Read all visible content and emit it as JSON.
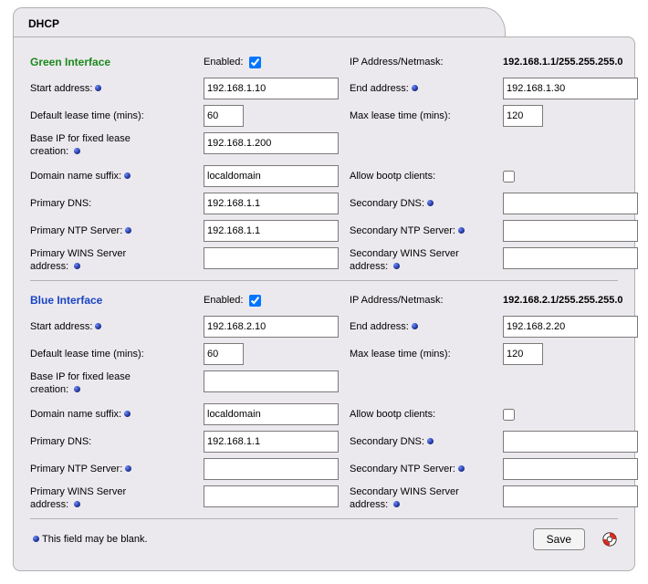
{
  "title": "DHCP",
  "labels": {
    "enabled": "Enabled:",
    "ip_netmask": "IP Address/Netmask:",
    "start_address": "Start address:",
    "end_address": "End address:",
    "default_lease": "Default lease time (mins):",
    "max_lease": "Max lease time (mins):",
    "base_ip_l1": "Base IP for fixed lease",
    "base_ip_l2": "creation:",
    "domain_suffix": "Domain name suffix:",
    "allow_bootp": "Allow bootp clients:",
    "primary_dns": "Primary DNS:",
    "secondary_dns": "Secondary DNS:",
    "primary_ntp": "Primary NTP Server:",
    "secondary_ntp": "Secondary NTP Server:",
    "primary_wins_l1": "Primary WINS Server",
    "primary_wins_l2": "address:",
    "secondary_wins_l1": "Secondary WINS Server",
    "secondary_wins_l2": "address:",
    "footer_note": "This field may be blank.",
    "save": "Save"
  },
  "green": {
    "heading": "Green Interface",
    "enabled": true,
    "ip_netmask": "192.168.1.1/255.255.255.0",
    "start_address": "192.168.1.10",
    "end_address": "192.168.1.30",
    "default_lease": "60",
    "max_lease": "120",
    "base_ip": "192.168.1.200",
    "domain_suffix": "localdomain",
    "allow_bootp": false,
    "primary_dns": "192.168.1.1",
    "secondary_dns": "",
    "primary_ntp": "192.168.1.1",
    "secondary_ntp": "",
    "primary_wins": "",
    "secondary_wins": ""
  },
  "blue": {
    "heading": "Blue Interface",
    "enabled": true,
    "ip_netmask": "192.168.2.1/255.255.255.0",
    "start_address": "192.168.2.10",
    "end_address": "192.168.2.20",
    "default_lease": "60",
    "max_lease": "120",
    "base_ip": "",
    "domain_suffix": "localdomain",
    "allow_bootp": false,
    "primary_dns": "192.168.1.1",
    "secondary_dns": "",
    "primary_ntp": "",
    "secondary_ntp": "",
    "primary_wins": "",
    "secondary_wins": ""
  }
}
